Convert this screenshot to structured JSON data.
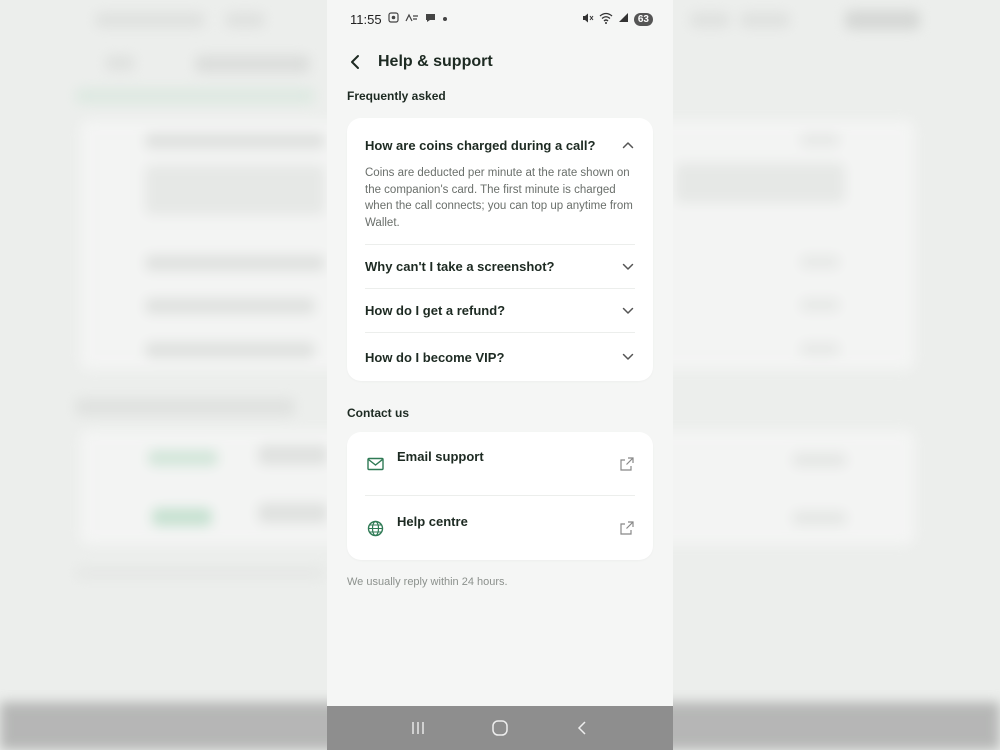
{
  "status_bar": {
    "time": "11:55",
    "battery": "63"
  },
  "header": {
    "title": "Help & support"
  },
  "faq": {
    "section_label": "Frequently asked",
    "items": [
      {
        "question": "How are coins charged during a call?",
        "expanded": true,
        "answer": "Coins are deducted per minute at the rate shown on the companion's card. The first minute is charged when the call connects; you can top up anytime from Wallet."
      },
      {
        "question": "Why can't I take a screenshot?",
        "expanded": false
      },
      {
        "question": "How do I get a refund?",
        "expanded": false
      },
      {
        "question": "How do I become VIP?",
        "expanded": false
      }
    ]
  },
  "contact": {
    "section_label": "Contact us",
    "items": [
      {
        "label": "Email support",
        "icon": "mail-icon"
      },
      {
        "label": "Help centre",
        "icon": "globe-icon"
      }
    ]
  },
  "footnote": "We usually reply within 24 hours.",
  "colors": {
    "accent": "#2f7a55",
    "text_primary": "#1d2a22",
    "text_secondary": "#6a6f6b",
    "background": "#f5f6f5",
    "card": "#ffffff"
  }
}
